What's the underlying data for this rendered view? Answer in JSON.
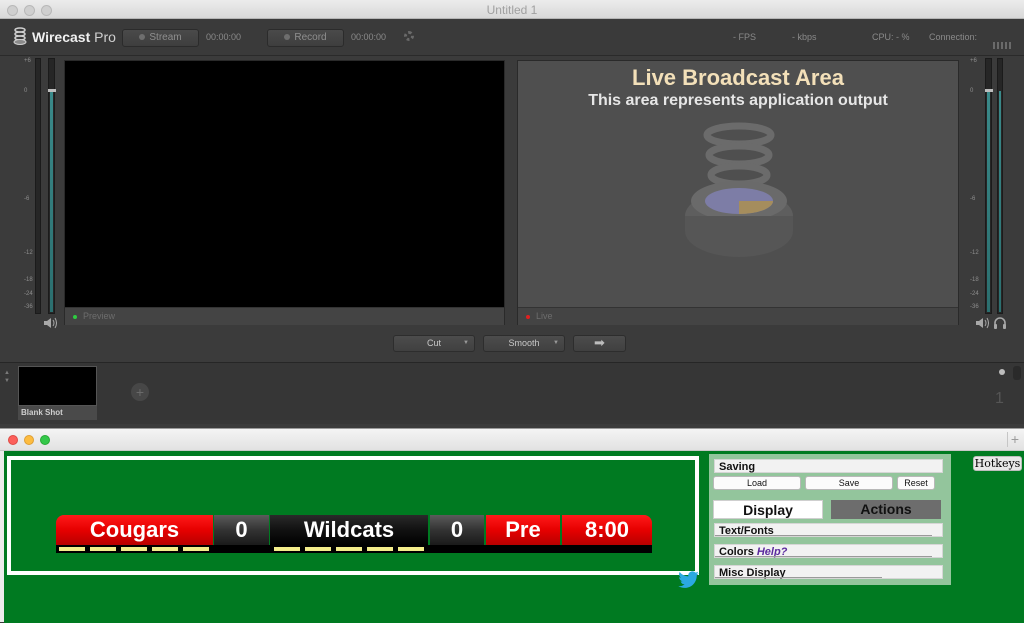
{
  "window": {
    "title": "Untitled 1"
  },
  "toolbar": {
    "app_name": "Wirecast",
    "app_edition": "Pro",
    "stream_label": "Stream",
    "stream_time": "00:00:00",
    "record_label": "Record",
    "record_time": "00:00:00",
    "fps_label": "- FPS",
    "kbps_label": "- kbps",
    "cpu_label": "CPU:  - %",
    "connection_label": "Connection:"
  },
  "meters": {
    "left_scale": [
      "+6",
      "0",
      "-6",
      "-12",
      "-18",
      "-24",
      "-36"
    ],
    "right_scale": [
      "+6",
      "0",
      "-6",
      "-12",
      "-18",
      "-24",
      "-36"
    ]
  },
  "preview": {
    "label": "Preview"
  },
  "live": {
    "title": "Live Broadcast Area",
    "subtitle": "This area represents application output",
    "label": "Live"
  },
  "transition": {
    "cut_label": "Cut",
    "smooth_label": "Smooth",
    "go_icon": "arrow-right-icon"
  },
  "shots": {
    "items": [
      {
        "label": "Blank Shot"
      }
    ],
    "layer_number": "1"
  },
  "scoreboard": {
    "home_team": "Cougars",
    "home_score": "0",
    "away_team": "Wildcats",
    "away_score": "0",
    "period": "Pre",
    "clock": "8:00",
    "colors": {
      "red": "#e60000",
      "dark": "#333333",
      "field_green": "#007a21",
      "timeout": "#f3ed8a"
    }
  },
  "panel": {
    "saving_label": "Saving",
    "load_label": "Load",
    "save_label": "Save",
    "reset_label": "Reset",
    "display_tab": "Display",
    "actions_tab": "Actions",
    "text_fonts_label": "Text/Fonts",
    "colors_label": "Colors",
    "help_label": "Help?",
    "misc_display_label": "Misc Display",
    "hotkeys_label": "Hotkeys"
  }
}
